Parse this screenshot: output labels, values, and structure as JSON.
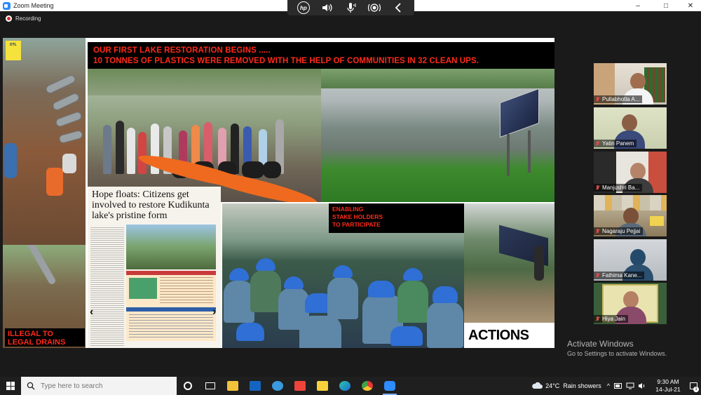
{
  "window": {
    "title": "Zoom Meeting",
    "recording_label": "Recording",
    "controls": {
      "minimize": "–",
      "maximize": "□",
      "close": "✕"
    }
  },
  "host_toolbar": {
    "brand": "hp",
    "icons": [
      "hp-logo-icon",
      "speaker-icon",
      "microphone-icon",
      "broadcast-icon",
      "chevron-left-icon"
    ]
  },
  "slide": {
    "headline_line1": "OUR FIRST LAKE RESTORATION BEGINS .....",
    "headline_line2": "10 TONNES OF PLASTICS WERE REMOVED WITH THE HELP OF COMMUNITIES IN 32 CLEAN UPS.",
    "illegal_drains_label": "ILLEGAL TO\nLEGAL DRAINS",
    "newspaper_headline": "Hope floats: Citizens get involved to restore Kudikunta lake's pristine form",
    "enabling_label": "ENABLING\nSTAKE HOLDERS\nTO PARTICIPATE",
    "actions_label": "ACTIONS",
    "headline_color": "#ff2a1a"
  },
  "participants": [
    {
      "name": "Pullabhotla A...",
      "muted": true
    },
    {
      "name": "Yatin Panem",
      "muted": true
    },
    {
      "name": "Manjushri Ba...",
      "muted": true
    },
    {
      "name": "Nagaraju Pejjai",
      "muted": true
    },
    {
      "name": "Fathima Kane...",
      "muted": true
    },
    {
      "name": "Hiya Jain",
      "muted": true
    }
  ],
  "watermark": {
    "line1": "Activate Windows",
    "line2": "Go to Settings to activate Windows."
  },
  "taskbar": {
    "search_placeholder": "Type here to search",
    "apps": [
      "cortana-icon",
      "task-view-icon",
      "file-explorer-icon",
      "outlook-icon",
      "edge-legacy-icon",
      "anydesk-icon",
      "sticky-notes-icon",
      "edge-icon",
      "chrome-icon",
      "zoom-icon"
    ],
    "weather": "24°C  Rain showers",
    "time": "9:30 AM",
    "date": "14-Jul-21",
    "notification_count": "1"
  }
}
